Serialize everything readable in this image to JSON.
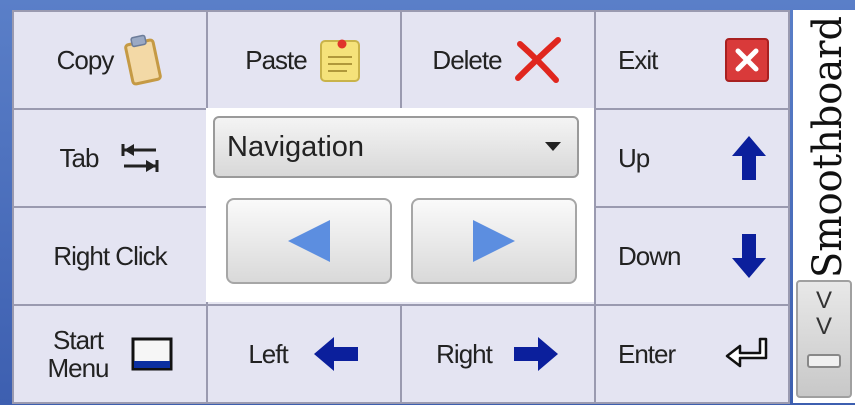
{
  "buttons": {
    "copy": "Copy",
    "paste": "Paste",
    "delete": "Delete",
    "exit": "Exit",
    "tab": "Tab",
    "up": "Up",
    "right_click": "Right Click",
    "down": "Down",
    "start_menu_line1": "Start",
    "start_menu_line2": "Menu",
    "left": "Left",
    "right": "Right",
    "enter": "Enter"
  },
  "navigation": {
    "selected": "Navigation"
  },
  "brand": {
    "name": "Smoothboard"
  },
  "scroll": {
    "top": "V",
    "mid": "V"
  },
  "icons": {
    "copy": "clipboard-icon",
    "paste": "sticky-note-icon",
    "delete": "red-x-icon",
    "exit": "close-icon",
    "tab": "tab-arrows-icon",
    "up": "up-arrow-icon",
    "down": "down-arrow-icon",
    "start_menu": "taskbar-icon",
    "left": "left-arrow-icon",
    "right": "right-arrow-icon",
    "enter": "enter-icon"
  },
  "colors": {
    "arrow_blue": "#0b1f9c",
    "delete_red": "#e0261e",
    "exit_red": "#d93a3a",
    "nav_triangle": "#5c8ee0"
  }
}
